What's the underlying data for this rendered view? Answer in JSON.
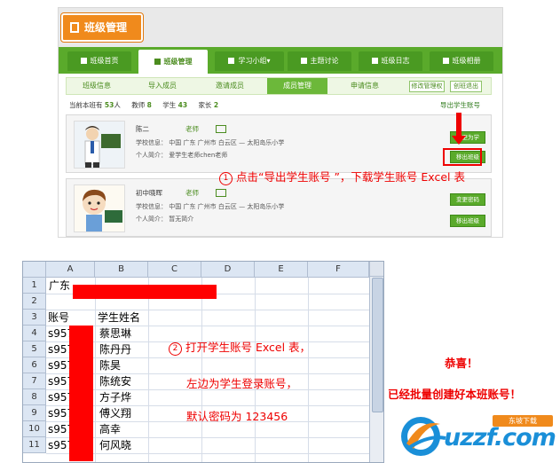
{
  "panel": {
    "title": "班级管理",
    "tabs": [
      "班级首页",
      "班级管理",
      "学习小组▾",
      "主题讨论",
      "班级日志",
      "班级相册"
    ],
    "subnav": [
      "班级信息",
      "导入成员",
      "邀请成员",
      "成员管理",
      "申请信息"
    ],
    "subnav_buttons": [
      "修改管理权",
      "创班退出"
    ],
    "stats": {
      "total_label": "当前本班有",
      "total_value": "53",
      "total_unit": "人",
      "teacher_label": "教师",
      "teacher_value": "8",
      "student_label": "学生",
      "student_value": "43",
      "parent_label": "家长",
      "parent_value": "2"
    },
    "export_link": "导出学生账号",
    "members": [
      {
        "name": "陈二",
        "role": "老师",
        "info": "学校信息：  中国  广东  广州市  白云区  —  太阳岛乐小学",
        "intro": "个人简介：  爱学生老师chen老师",
        "buttons": [
          "变更为学",
          "移出班级"
        ]
      },
      {
        "name": "初中晓晖",
        "role": "老师",
        "info": "学校信息：  中国  广东  广州市  白云区  —  太阳岛乐小学",
        "intro": "个人简介：  暂无简介",
        "buttons": [
          "变更密码",
          "移出班级"
        ]
      }
    ],
    "annotation_1_num": "1",
    "annotation_1": "点击“导出学生账号 ”，下载学生账号 Excel 表"
  },
  "sheet": {
    "columns": [
      "A",
      "B",
      "C",
      "D",
      "E",
      "F"
    ],
    "rows": [
      "1",
      "2",
      "3",
      "4",
      "5",
      "6",
      "7",
      "8",
      "9",
      "10",
      "11"
    ],
    "a1": "广东",
    "header_account": "账号",
    "header_name": "学生姓名",
    "account_prefix": "s957",
    "students": [
      "蔡思琳",
      "陈丹丹",
      "陈昊",
      "陈统安",
      "方子烨",
      "傅义翔",
      "高幸",
      "何风晓"
    ],
    "annotation_2_num": "2",
    "annotation_2_line1": "打开学生账号 Excel 表，",
    "annotation_2_line2": "左边为学生登录账号，",
    "annotation_2_line3": "默认密码为 123456"
  },
  "right": {
    "congrats": "恭喜！",
    "done": "已经批量创建好本班账号！",
    "logo_text": "uzzf.com",
    "logo_tag": "东坡下载"
  },
  "colors": {
    "green": "#5aaa2b",
    "orange": "#f08a1c",
    "red": "#ee0000",
    "logo_blue": "#1a8fd8"
  }
}
